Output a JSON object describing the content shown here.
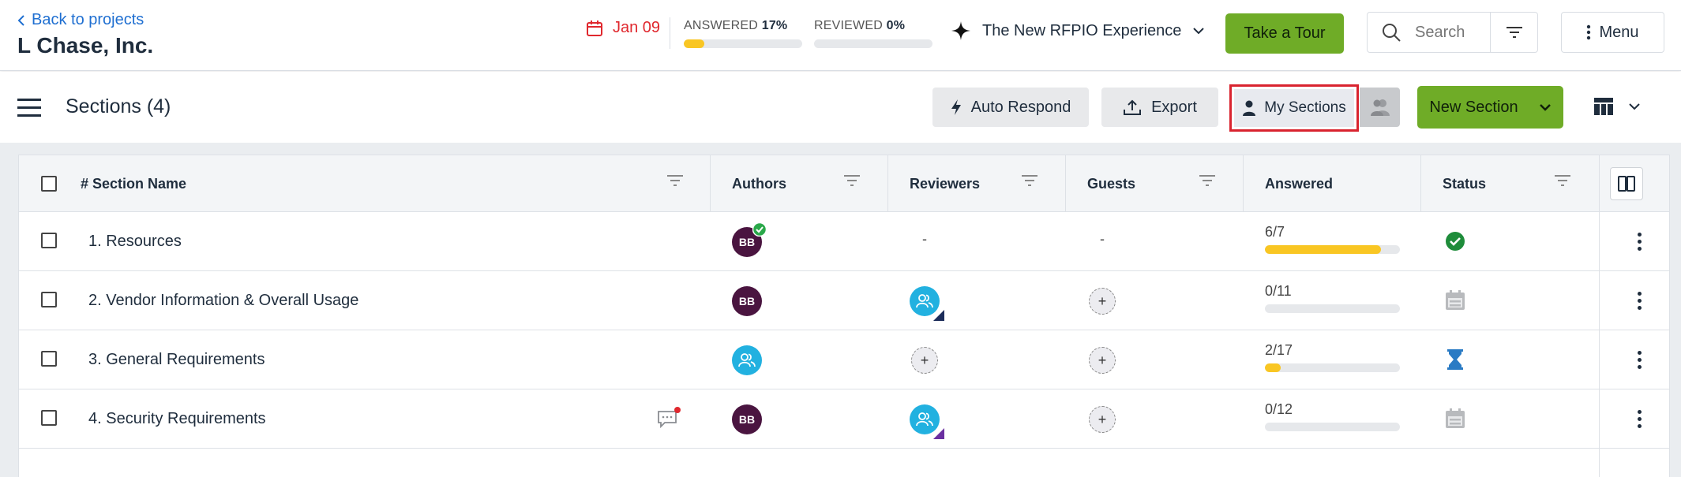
{
  "header": {
    "back_label": "Back to projects",
    "company": "L Chase, Inc.",
    "due_date": "Jan 09",
    "answered_label": "ANSWERED",
    "answered_pct": "17%",
    "answered_fraction": 0.17,
    "reviewed_label": "REVIEWED",
    "reviewed_pct": "0%",
    "reviewed_fraction": 0.0,
    "experience_label": "The New RFPIO Experience",
    "tour_label": "Take a Tour",
    "search_placeholder": "Search",
    "menu_label": "Menu"
  },
  "toolbar": {
    "title": "Sections (4)",
    "auto_respond": "Auto Respond",
    "export": "Export",
    "my_sections": "My Sections",
    "new_section": "New Section"
  },
  "table": {
    "columns": {
      "section_name": "# Section Name",
      "authors": "Authors",
      "reviewers": "Reviewers",
      "guests": "Guests",
      "answered": "Answered",
      "status": "Status"
    },
    "rows": [
      {
        "name": "1. Resources",
        "author": "BB",
        "reviewer": "-",
        "guest": "-",
        "answered": "6/7",
        "answered_fraction": 0.857,
        "status": "complete"
      },
      {
        "name": "2. Vendor Information & Overall Usage",
        "author": "BB",
        "reviewer": "group",
        "guest": "add",
        "answered": "0/11",
        "answered_fraction": 0.0,
        "status": "scheduled"
      },
      {
        "name": "3. General Requirements",
        "author": "group",
        "reviewer": "add",
        "guest": "add",
        "answered": "2/17",
        "answered_fraction": 0.118,
        "status": "in-progress"
      },
      {
        "name": "4. Security Requirements",
        "author": "BB",
        "reviewer": "group",
        "guest": "add",
        "answered": "0/12",
        "answered_fraction": 0.0,
        "status": "scheduled"
      }
    ]
  },
  "colors": {
    "accent_green": "#6fac27",
    "progress_yellow": "#f9c623",
    "avatar_purple": "#4a1540",
    "group_blue": "#22b1e0",
    "highlight_red": "#d9232f",
    "due_red": "#e0282e"
  }
}
